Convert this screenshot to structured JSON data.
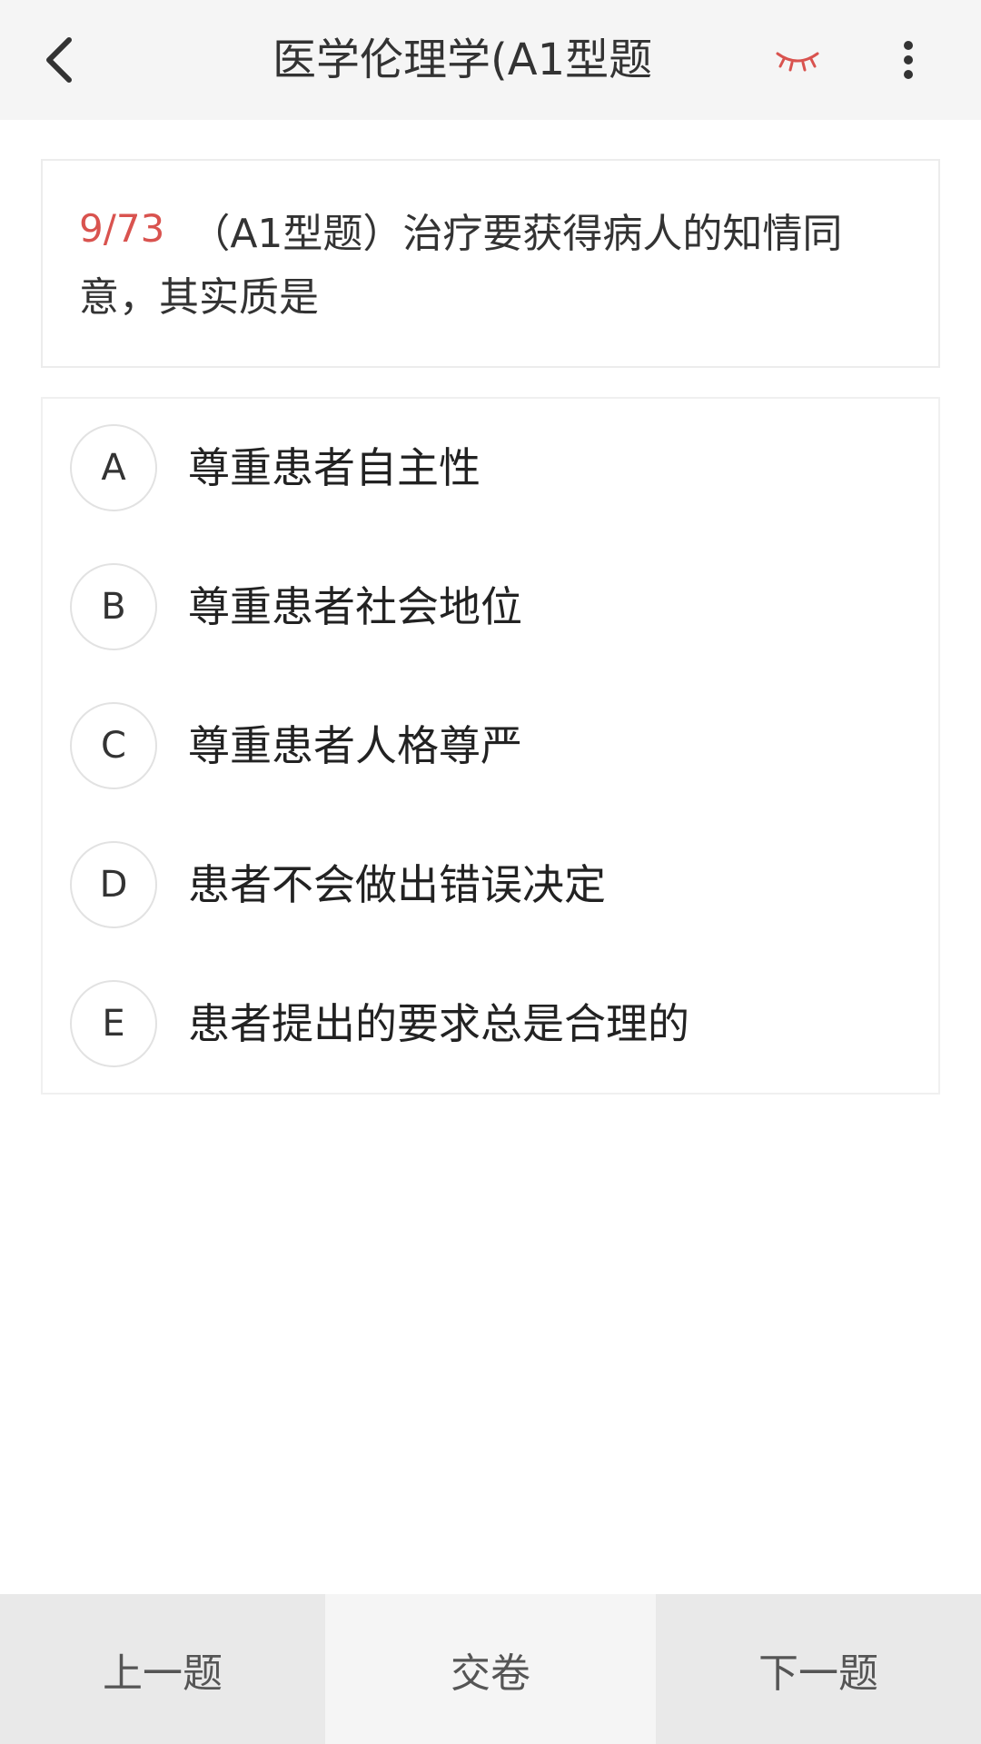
{
  "header": {
    "title": "医学伦理学(A1型题",
    "icons": {
      "back": "chevron-left-icon",
      "eye": "closed-eye-icon",
      "more": "more-vertical-icon"
    },
    "eye_color": "#d9534f"
  },
  "question": {
    "number": "9/73",
    "text": "（A1型题）治疗要获得病人的知情同意，其实质是",
    "number_color": "#d9534f"
  },
  "options": [
    {
      "letter": "A",
      "text": "尊重患者自主性"
    },
    {
      "letter": "B",
      "text": "尊重患者社会地位"
    },
    {
      "letter": "C",
      "text": "尊重患者人格尊严"
    },
    {
      "letter": "D",
      "text": "患者不会做出错误决定"
    },
    {
      "letter": "E",
      "text": "患者提出的要求总是合理的"
    }
  ],
  "bottom_bar": {
    "prev_label": "上一题",
    "submit_label": "交卷",
    "next_label": "下一题"
  }
}
